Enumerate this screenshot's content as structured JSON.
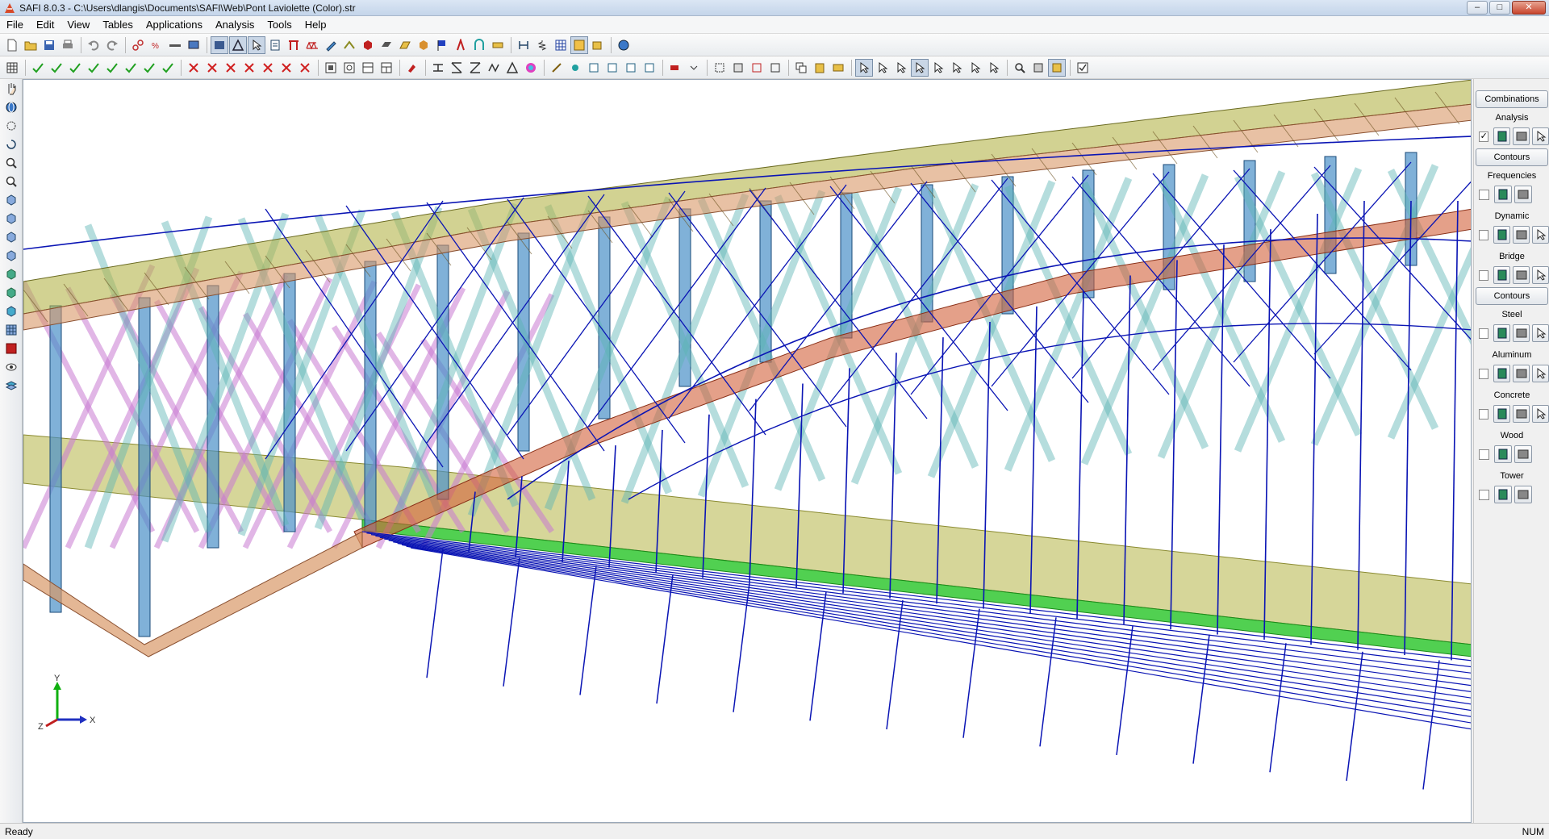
{
  "window": {
    "title": "SAFI 8.0.3 - C:\\Users\\dlangis\\Documents\\SAFI\\Web\\Pont Laviolette (Color).str",
    "minimize": "–",
    "maximize": "□",
    "close": "✕"
  },
  "menu": [
    "File",
    "Edit",
    "View",
    "Tables",
    "Applications",
    "Analysis",
    "Tools",
    "Help"
  ],
  "right_panel": {
    "combinations_button": "Combinations",
    "analysis_label": "Analysis",
    "contours_button": "Contours",
    "frequencies_label": "Frequencies",
    "dynamic_label": "Dynamic",
    "bridge_label": "Bridge",
    "bridge_contours_button": "Contours",
    "steel_label": "Steel",
    "aluminum_label": "Aluminum",
    "concrete_label": "Concrete",
    "wood_label": "Wood",
    "tower_label": "Tower",
    "analysis_checked": "✓"
  },
  "axes": {
    "x": "X",
    "y": "Y",
    "z": "Z"
  },
  "status": {
    "left": "Ready",
    "right": "NUM"
  },
  "colors": {
    "wire": "#0a14b4",
    "truss_olive": "#b4b44a",
    "truss_tan": "#d89868",
    "column_blue": "#4a90c8",
    "diagonal_cyan": "#5ab4b4",
    "brace_purple": "#c87ad2",
    "arch_red": "#d2603a",
    "deck_olive": "#b4b446",
    "deck_green": "#32c832"
  }
}
